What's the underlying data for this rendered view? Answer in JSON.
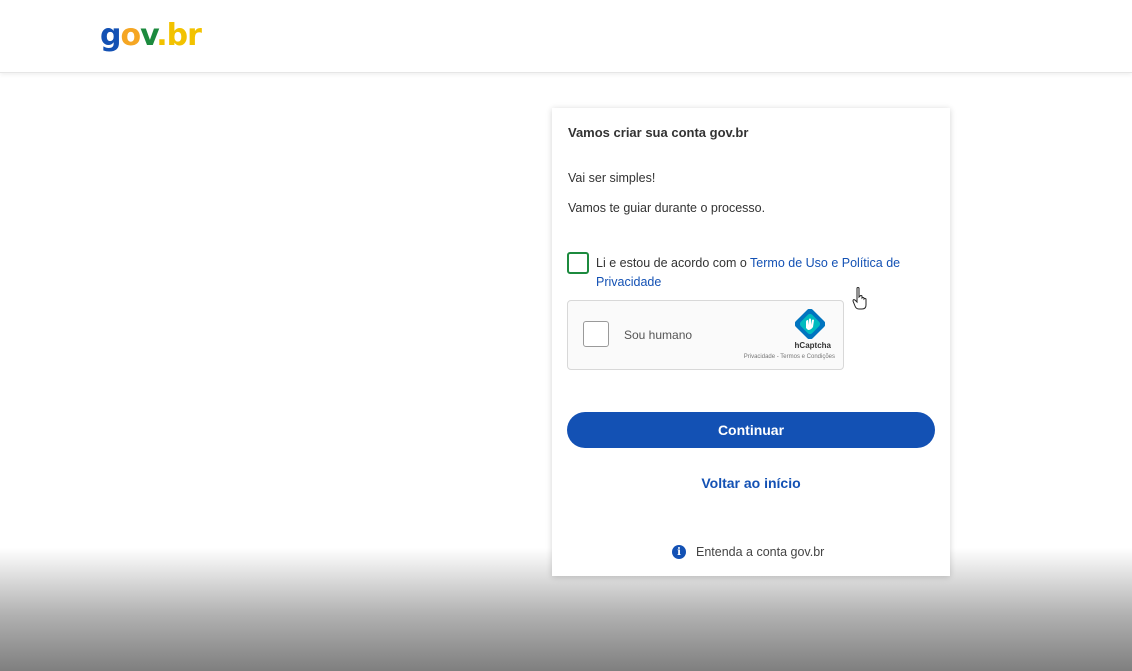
{
  "header": {
    "logo": {
      "part1": "g",
      "part2": "o",
      "part3": "v",
      "part4": ".br"
    }
  },
  "card": {
    "title": "Vamos criar sua conta gov.br",
    "line1": "Vai ser simples!",
    "line2": "Vamos te guiar durante o processo.",
    "terms": {
      "prefix": "Li e estou de acordo com o ",
      "link": "Termo de Uso e Política de Privacidade",
      "checked": false
    },
    "captcha": {
      "label": "Sou humano",
      "brand": "hCaptcha",
      "links": "Privacidade - Termos e Condições"
    },
    "continue_label": "Continuar",
    "back_label": "Voltar ao início",
    "info_label": "Entenda a conta gov.br"
  },
  "colors": {
    "primary": "#1351b4",
    "checkbox_border": "#1c8a3e",
    "logo_blue": "#1351b4",
    "logo_orange": "#f5a623",
    "logo_green": "#1c8a3e",
    "logo_yellow": "#f2c200"
  },
  "icons": [
    "info-icon",
    "hcaptcha-logo-icon",
    "hand-pointer-icon"
  ]
}
